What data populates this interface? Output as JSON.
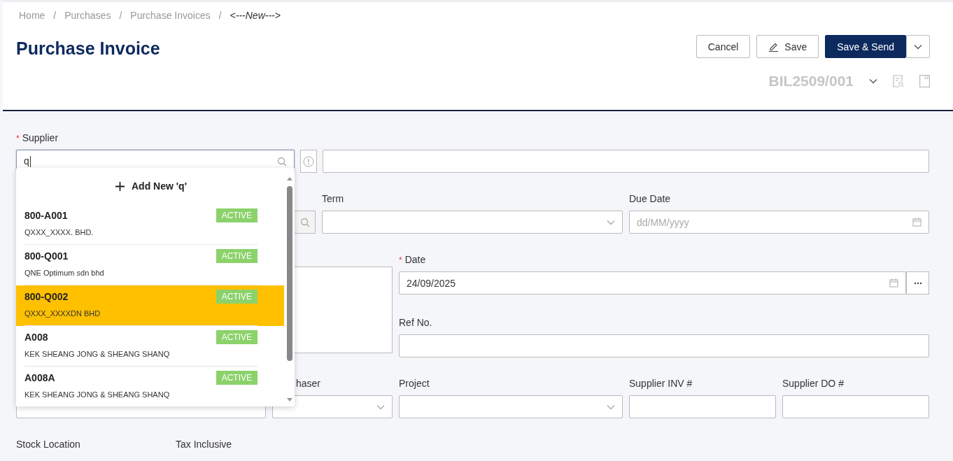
{
  "breadcrumb": {
    "separator": "/",
    "items": [
      {
        "label": "Home",
        "current": false
      },
      {
        "label": "Purchases",
        "current": false
      },
      {
        "label": "Purchase Invoices",
        "current": false
      },
      {
        "label": "<---New--->",
        "current": true
      }
    ]
  },
  "page_title": "Purchase Invoice",
  "actions": [
    {
      "kind": "outline",
      "label": "Cancel"
    },
    {
      "kind": "edit",
      "label": "Save"
    },
    {
      "kind": "primary",
      "label": "Save & Send"
    },
    {
      "kind": "caret"
    }
  ],
  "document_number": "BIL2509/001",
  "supplier": {
    "label": "Supplier",
    "required_mark": "*",
    "value": "q"
  },
  "supplier_dropdown": {
    "add_new": "Add New 'q'",
    "options": [
      {
        "code": "800-A001",
        "name": "QXXX_XXXX. BHD.",
        "status": "ACTIVE",
        "selected": false
      },
      {
        "code": "800-Q001",
        "name": "QNE Optimum sdn bhd",
        "status": "ACTIVE",
        "selected": false
      },
      {
        "code": "800-Q002",
        "name": "QXXX_XXXXDN BHD",
        "status": "ACTIVE",
        "selected": true
      },
      {
        "code": "A008",
        "name": "KEK SHEANG JONG & SHEANG SHANQ",
        "status": "ACTIVE",
        "selected": false
      },
      {
        "code": "A008A",
        "name": "KEK SHEANG JONG & SHEANG SHANQ",
        "status": "ACTIVE",
        "selected": false
      }
    ]
  },
  "term": {
    "label": "Term"
  },
  "due_date": {
    "label": "Due Date",
    "placeholder": "dd/MM/yyyy"
  },
  "date": {
    "label": "Date",
    "required_mark": "*",
    "value": "24/09/2025"
  },
  "ref_no": {
    "label": "Ref No."
  },
  "purchaser": {
    "label": "haser"
  },
  "project": {
    "label": "Project"
  },
  "supplier_inv": {
    "label": "Supplier INV #"
  },
  "supplier_do": {
    "label": "Supplier DO #"
  },
  "stock_location": {
    "label": "Stock Location"
  },
  "tax_inclusive": {
    "label": "Tax Inclusive"
  }
}
